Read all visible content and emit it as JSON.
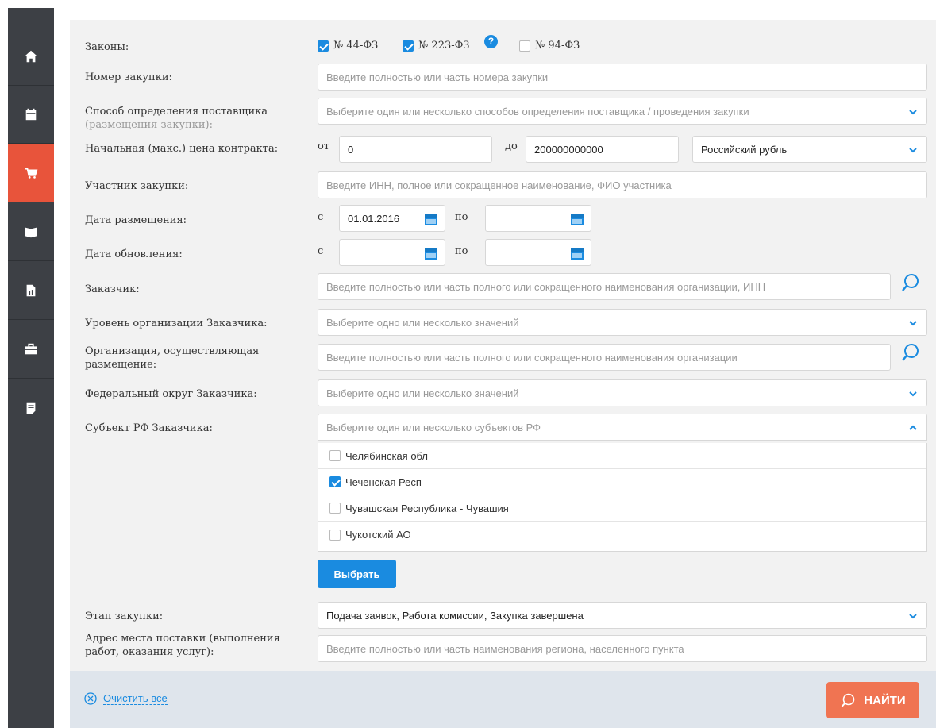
{
  "sidebar": {
    "items": [
      {
        "name": "home-icon"
      },
      {
        "name": "calendar-icon"
      },
      {
        "name": "cart-icon",
        "active": true
      },
      {
        "name": "book-icon"
      },
      {
        "name": "report-icon"
      },
      {
        "name": "briefcase-icon"
      },
      {
        "name": "document-icon"
      }
    ]
  },
  "form": {
    "laws": {
      "label": "Законы:",
      "options": [
        {
          "label": "№ 44-ФЗ",
          "checked": true
        },
        {
          "label": "№ 223-ФЗ",
          "checked": true
        },
        {
          "label": "№ 94-ФЗ",
          "checked": false
        }
      ],
      "help": "?"
    },
    "purchase_number": {
      "label": "Номер закупки:",
      "placeholder": "Введите полностью или часть номера закупки"
    },
    "supplier_method": {
      "label": "Способ определения поставщика",
      "sublabel": "(размещения закупки):",
      "placeholder": "Выберите один или несколько способов определения поставщика / проведения закупки"
    },
    "price": {
      "label": "Начальная (макс.) цена контракта:",
      "from_label": "от",
      "from_value": "0",
      "to_label": "до",
      "to_value": "200000000000",
      "currency": "Российский рубль"
    },
    "participant": {
      "label": "Участник закупки:",
      "placeholder": "Введите ИНН, полное или сокращенное наименование, ФИО участника"
    },
    "publish_date": {
      "label": "Дата размещения:",
      "from_label": "с",
      "from_value": "01.01.2016",
      "to_label": "по",
      "to_value": ""
    },
    "update_date": {
      "label": "Дата обновления:",
      "from_label": "с",
      "from_value": "",
      "to_label": "по",
      "to_value": ""
    },
    "customer": {
      "label": "Заказчик:",
      "placeholder": "Введите полностью или часть полного или сокращенного наименования организации, ИНН"
    },
    "customer_level": {
      "label": "Уровень организации Заказчика:",
      "placeholder": "Выберите одно или несколько значений"
    },
    "placing_org": {
      "label": "Организация, осуществляющая размещение:",
      "placeholder": "Введите полностью или часть полного или сокращенного наименования организации"
    },
    "federal_district": {
      "label": "Федеральный округ Заказчика:",
      "placeholder": "Выберите одно или несколько значений"
    },
    "region": {
      "label": "Субъект РФ Заказчика:",
      "placeholder": "Выберите один или несколько субъектов РФ",
      "options": [
        {
          "label": "Челябинская обл",
          "checked": false
        },
        {
          "label": "Чеченская Респ",
          "checked": true
        },
        {
          "label": "Чувашская Республика - Чувашия",
          "checked": false
        },
        {
          "label": "Чукотский АО",
          "checked": false
        }
      ],
      "select_button": "Выбрать"
    },
    "stage": {
      "label": "Этап закупки:",
      "value": "Подача заявок, Работа комиссии, Закупка завершена"
    },
    "address": {
      "label": "Адрес места поставки (выполнения работ, оказания услуг):",
      "placeholder": "Введите полностью или часть наименования региона, населенного пункта"
    }
  },
  "footer": {
    "clear_label": "Очистить все",
    "find_label": "НАЙТИ"
  },
  "colors": {
    "accent": "#1a8be0",
    "active_sidebar": "#e8543b",
    "find_button": "#f07452"
  }
}
